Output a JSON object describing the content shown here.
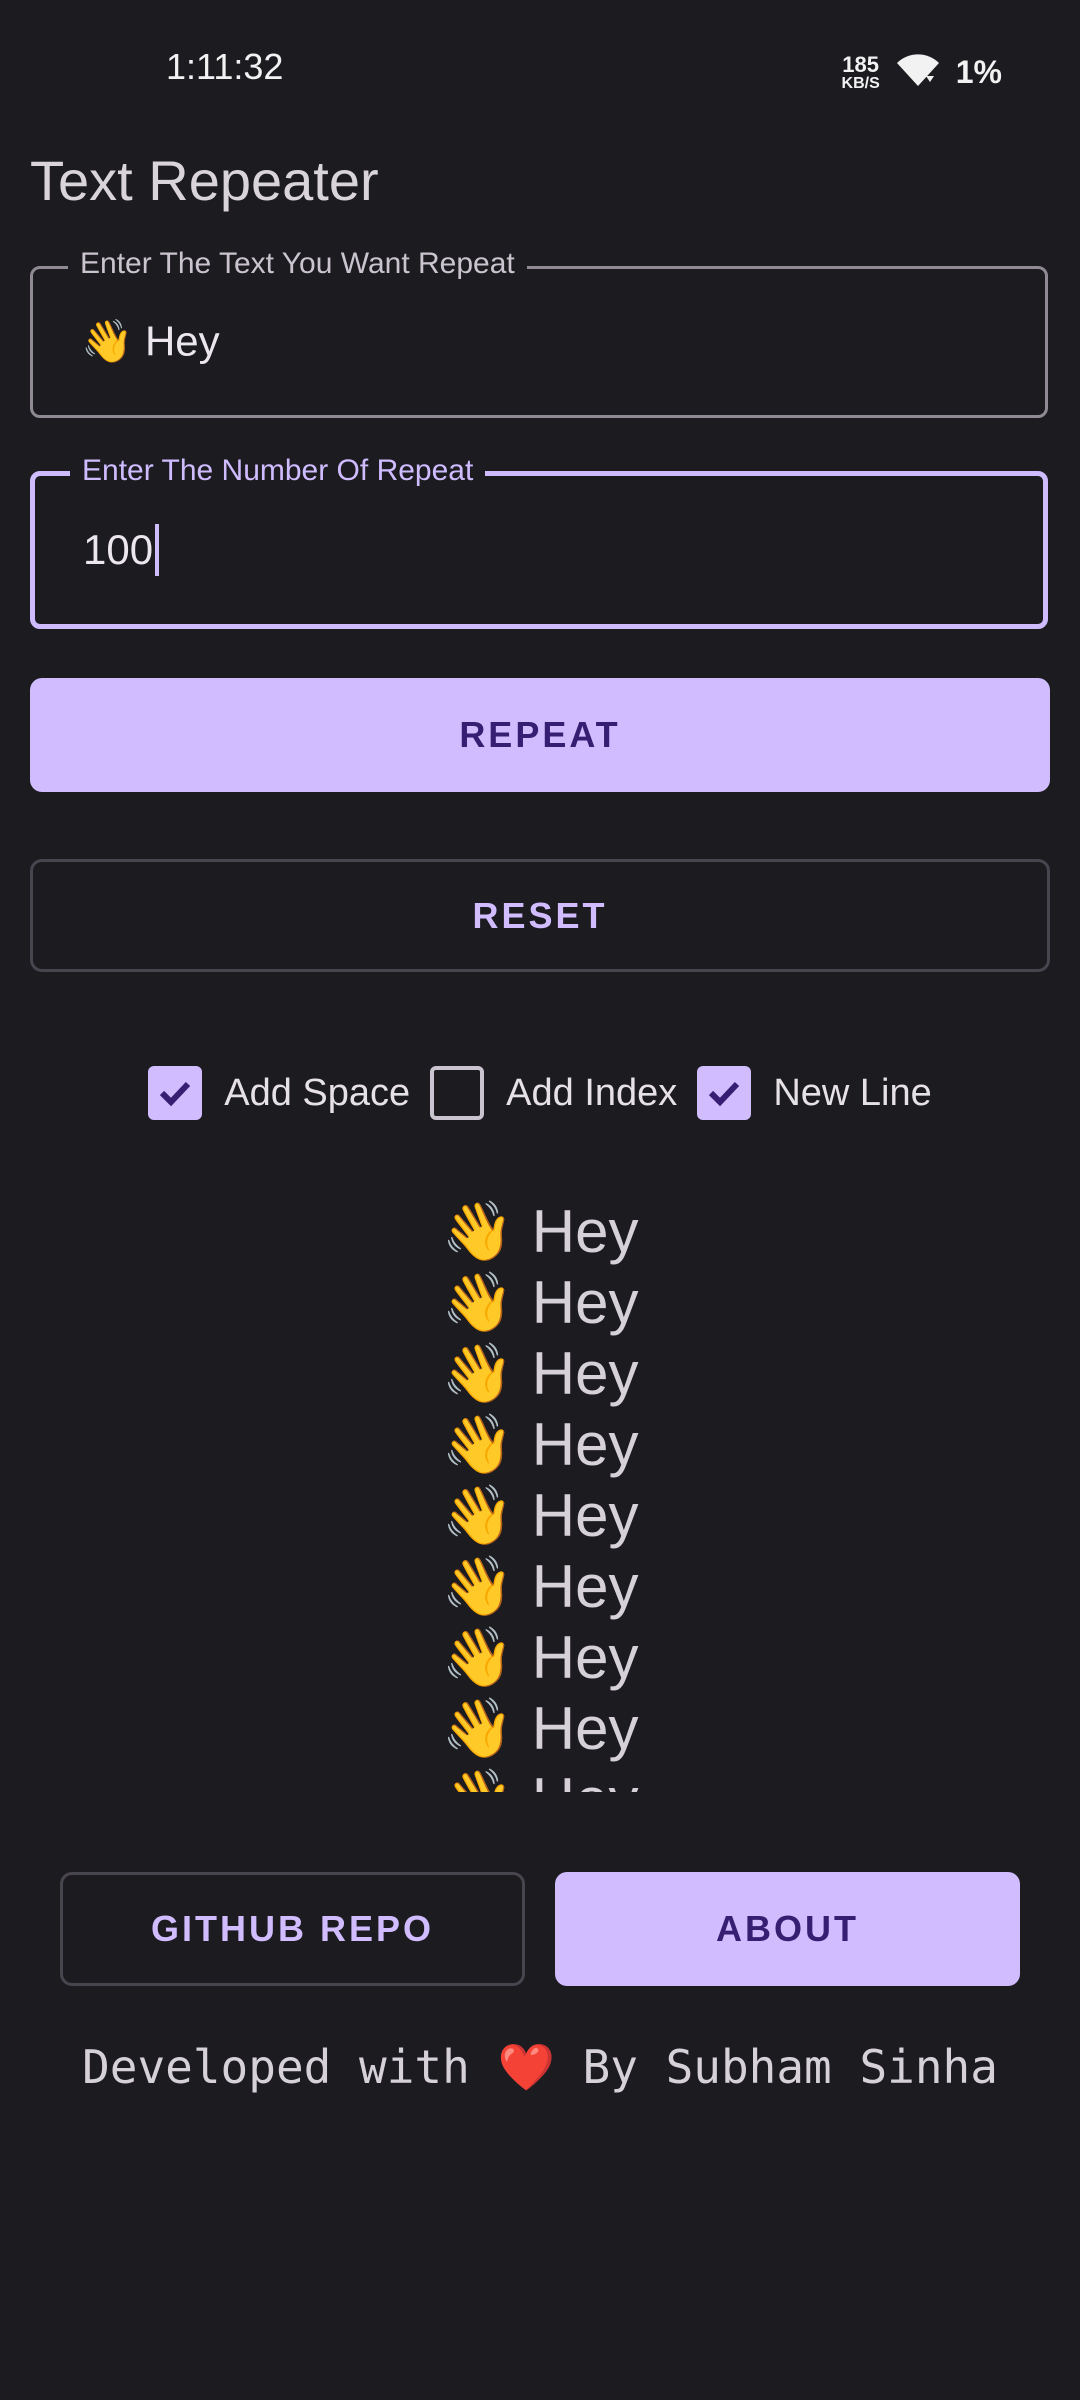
{
  "status_bar": {
    "time": "1:11:32",
    "net_speed_value": "185",
    "net_speed_unit": "KB/S",
    "battery": "1%"
  },
  "app": {
    "title": "Text Repeater"
  },
  "text_field": {
    "label": "Enter The Text You Want Repeat",
    "value": "👋 Hey"
  },
  "number_field": {
    "label": "Enter The Number Of Repeat",
    "value": "100"
  },
  "buttons": {
    "repeat": "REPEAT",
    "reset": "RESET",
    "github": "GITHUB REPO",
    "about": "ABOUT"
  },
  "options": {
    "add_space": {
      "label": "Add Space",
      "checked": true
    },
    "add_index": {
      "label": "Add Index",
      "checked": false
    },
    "new_line": {
      "label": "New Line",
      "checked": true
    }
  },
  "output": {
    "emoji": "👋",
    "text": "Hey",
    "visible_lines": 9
  },
  "footer": {
    "prefix": "Developed with",
    "heart": "❤️",
    "suffix": "By Subham Sinha"
  },
  "colors": {
    "background": "#1c1b20",
    "accent": "#d0bcff",
    "on_accent": "#381e72",
    "outline": "#49454f"
  }
}
